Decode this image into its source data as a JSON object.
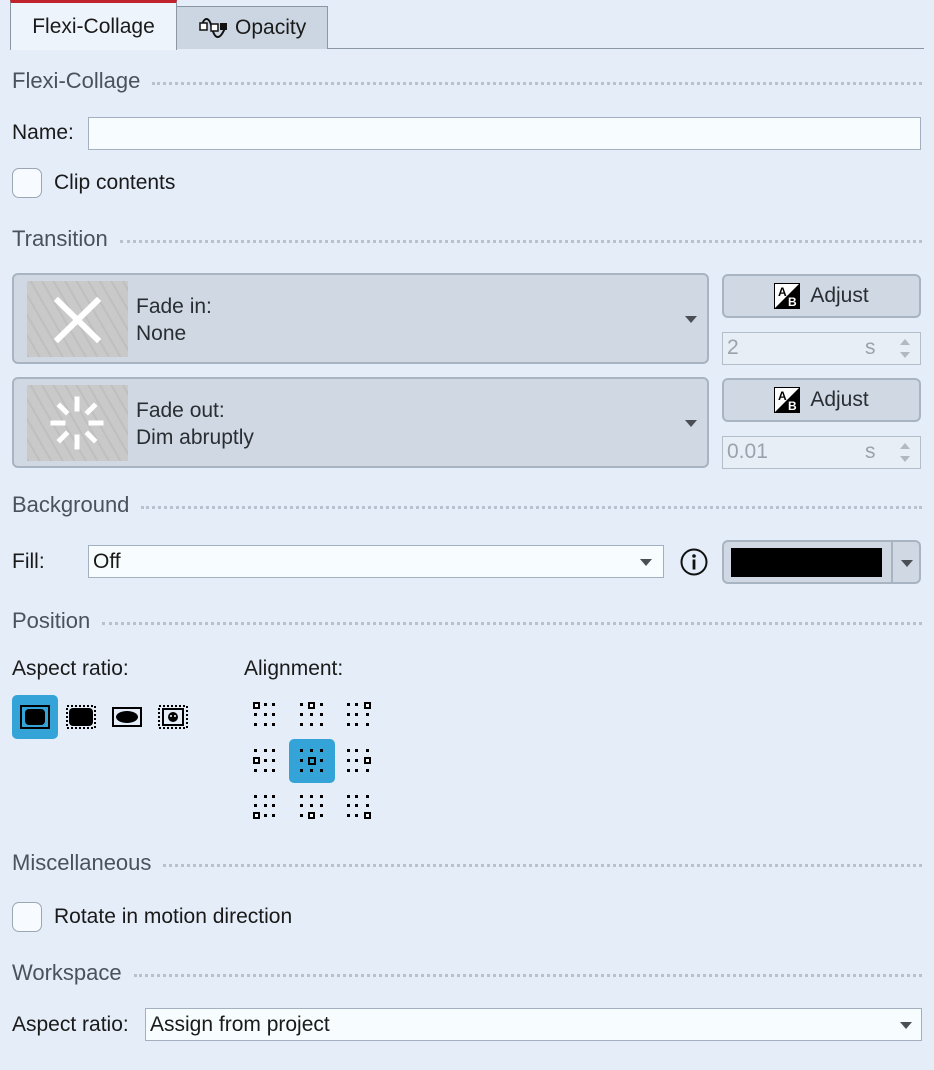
{
  "tabs": [
    {
      "label": "Flexi-Collage",
      "active": true
    },
    {
      "label": "Opacity",
      "active": false,
      "icon": "opacity-curve-icon"
    }
  ],
  "sections": {
    "flexi_collage": "Flexi-Collage",
    "transition": "Transition",
    "background": "Background",
    "position": "Position",
    "miscellaneous": "Miscellaneous",
    "workspace": "Workspace"
  },
  "flexi": {
    "name_label": "Name:",
    "name_value": "",
    "clip_label": "Clip contents",
    "clip_checked": false
  },
  "transition": {
    "fade_in": {
      "title": "Fade in:",
      "value": "None",
      "icon": "x-icon"
    },
    "fade_out": {
      "title": "Fade out:",
      "value": "Dim abruptly",
      "icon": "burst-icon"
    },
    "adjust_label": "Adjust",
    "fade_in_duration": "2",
    "fade_out_duration": "0.01",
    "unit": "s"
  },
  "background": {
    "fill_label": "Fill:",
    "fill_value": "Off",
    "color": "#000000"
  },
  "position": {
    "aspect_label": "Aspect ratio:",
    "alignment_label": "Alignment:",
    "aspect_selected_index": 0,
    "alignment_selected": "center"
  },
  "misc": {
    "rotate_label": "Rotate in motion direction",
    "rotate_checked": false
  },
  "workspace": {
    "aspect_label": "Aspect ratio:",
    "aspect_value": "Assign from project"
  },
  "colors": {
    "background": "#e4edf8",
    "selected": "#34a3d8",
    "active_tab_accent": "#c0232b"
  }
}
